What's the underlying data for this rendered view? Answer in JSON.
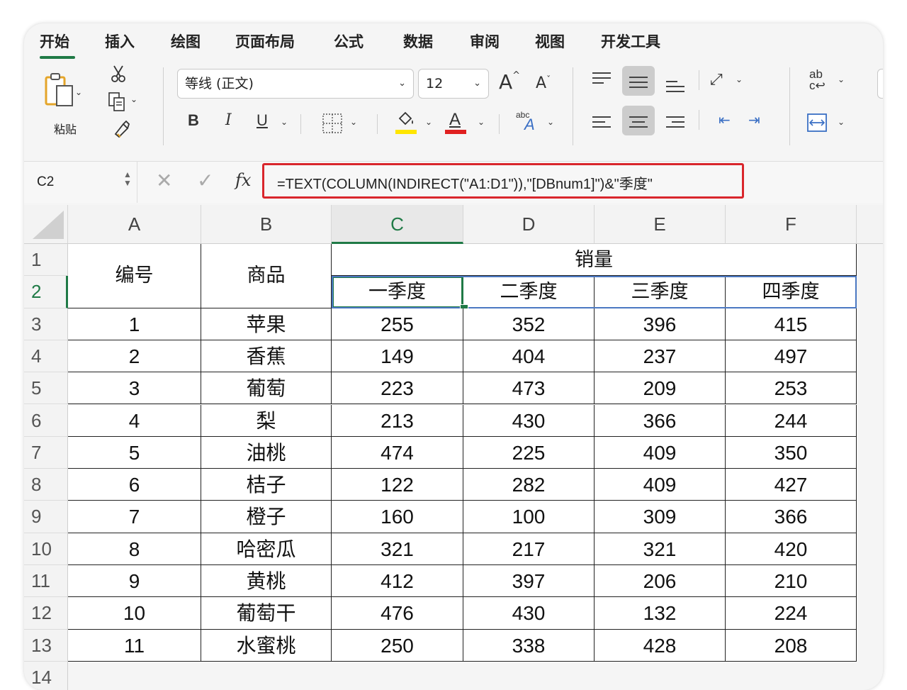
{
  "ribbon_tabs": [
    "开始",
    "插入",
    "绘图",
    "页面布局",
    "公式",
    "数据",
    "审阅",
    "视图",
    "开发工具"
  ],
  "ribbon": {
    "paste_label": "粘贴",
    "font_name": "等线 (正文)",
    "font_size": "12",
    "bold": "B",
    "italic": "I",
    "underline": "U",
    "font_color_glyph": "A",
    "font_color": "#e02020",
    "highlight_color": "#ffe600",
    "abc_glyph": "abc",
    "accent": "#1f7a46"
  },
  "formula_bar": {
    "name_box": "C2",
    "fx_label": "fx",
    "formula": "=TEXT(COLUMN(INDIRECT(\"A1:D1\")),\"[DBnum1]\")&\"季度\"",
    "highlight_color": "#d9262c"
  },
  "columns": [
    "A",
    "B",
    "C",
    "D",
    "E",
    "F"
  ],
  "active_column": "C",
  "row_numbers": [
    "1",
    "2",
    "3",
    "4",
    "5",
    "6",
    "7",
    "8",
    "9",
    "10",
    "11",
    "12",
    "13",
    "14"
  ],
  "active_row": "2",
  "header": {
    "id_label": "编号",
    "product_label": "商品",
    "sales_label": "销量",
    "quarters": [
      "一季度",
      "二季度",
      "三季度",
      "四季度"
    ]
  },
  "rows": [
    {
      "id": "1",
      "product": "苹果",
      "q": [
        "255",
        "352",
        "396",
        "415"
      ]
    },
    {
      "id": "2",
      "product": "香蕉",
      "q": [
        "149",
        "404",
        "237",
        "497"
      ]
    },
    {
      "id": "3",
      "product": "葡萄",
      "q": [
        "223",
        "473",
        "209",
        "253"
      ]
    },
    {
      "id": "4",
      "product": "梨",
      "q": [
        "213",
        "430",
        "366",
        "244"
      ]
    },
    {
      "id": "5",
      "product": "油桃",
      "q": [
        "474",
        "225",
        "409",
        "350"
      ]
    },
    {
      "id": "6",
      "product": "桔子",
      "q": [
        "122",
        "282",
        "409",
        "427"
      ]
    },
    {
      "id": "7",
      "product": "橙子",
      "q": [
        "160",
        "100",
        "309",
        "366"
      ]
    },
    {
      "id": "8",
      "product": "哈密瓜",
      "q": [
        "321",
        "217",
        "321",
        "420"
      ]
    },
    {
      "id": "9",
      "product": "黄桃",
      "q": [
        "412",
        "397",
        "206",
        "210"
      ]
    },
    {
      "id": "10",
      "product": "葡萄干",
      "q": [
        "476",
        "430",
        "132",
        "224"
      ]
    },
    {
      "id": "11",
      "product": "水蜜桃",
      "q": [
        "250",
        "338",
        "428",
        "208"
      ]
    }
  ]
}
